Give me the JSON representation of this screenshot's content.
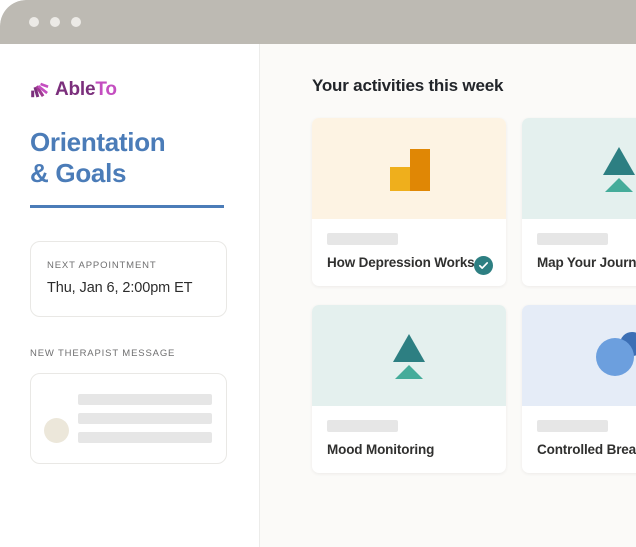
{
  "window": {
    "traffic_lights": [
      "dot-1",
      "dot-2",
      "dot-3"
    ],
    "chrome_color": "#bdbab3"
  },
  "sidebar": {
    "brand": {
      "mark_icon": "ableto-rays-icon",
      "name_part_1": "Able",
      "name_part_2": "To",
      "color_primary": "#7b2f7c",
      "color_secondary": "#c44ec0"
    },
    "page_title": "Orientation\n& Goals",
    "title_accent_color": "#4b7cb8",
    "appointment": {
      "label": "NEXT APPOINTMENT",
      "value": "Thu, Jan 6, 2:00pm ET"
    },
    "message": {
      "label": "NEW THERAPIST MESSAGE",
      "avatar_icon": "avatar-placeholder-icon",
      "placeholder_lines": 3
    }
  },
  "main": {
    "heading": "Your activities this week",
    "activities": [
      {
        "title": "How Depression Works",
        "art_icon": "bar-chart-icon",
        "art_background": "#fdf3e3",
        "completed": true,
        "badge_icon": "check-circle-icon",
        "badge_color": "#2d7f82"
      },
      {
        "title": "Map Your Journe",
        "art_icon": "tree-icon",
        "art_background": "#e4f0ee",
        "completed": false
      },
      {
        "title": "Mood Monitoring",
        "art_icon": "tree-icon",
        "art_background": "#e4f0ee",
        "completed": false
      },
      {
        "title": "Controlled Breat",
        "art_icon": "circles-icon",
        "art_background": "#e5ecf7",
        "completed": false
      }
    ]
  }
}
